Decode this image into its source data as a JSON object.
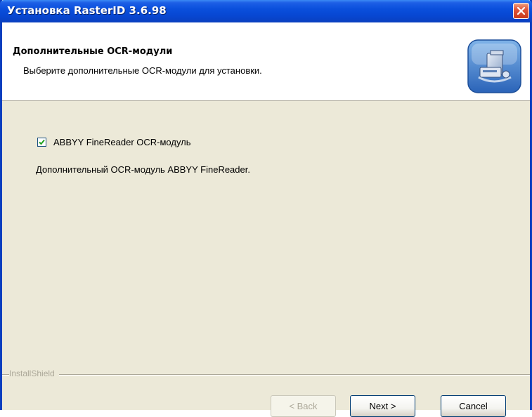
{
  "window": {
    "title": "Установка RasterID 3.6.98"
  },
  "header": {
    "title": "Дополнительные OCR-модули",
    "subtitle": "Выберите дополнительные OCR-модули для установки.",
    "icon": "installer-computer-icon"
  },
  "options": [
    {
      "label": "ABBYY FineReader OCR-модуль",
      "checked": true,
      "description": "Дополнительный OCR-модуль ABBYY FineReader."
    }
  ],
  "footer": {
    "brand": "InstallShield",
    "back_label": "< Back",
    "back_enabled": false,
    "next_label": "Next >",
    "cancel_label": "Cancel"
  },
  "colors": {
    "titlebar": "#0a4fdc",
    "window_bg": "#ece9d8",
    "header_bg": "#ffffff",
    "close_button": "#e0553a"
  }
}
